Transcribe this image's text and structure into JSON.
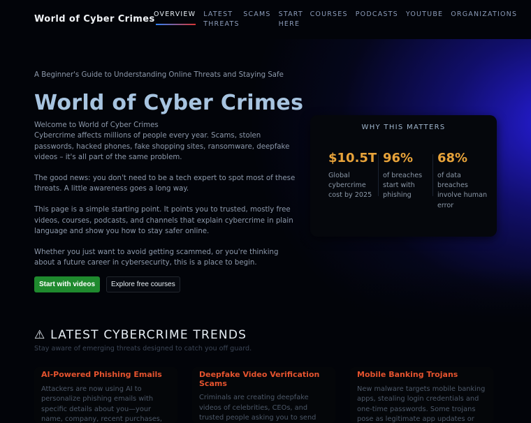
{
  "brand": "World of Cyber Crimes",
  "nav": [
    {
      "label": "OVERVIEW",
      "active": true
    },
    {
      "label": "LATEST THREATS"
    },
    {
      "label": "SCAMS"
    },
    {
      "label": "START HERE"
    },
    {
      "label": "COURSES"
    },
    {
      "label": "PODCASTS"
    },
    {
      "label": "YOUTUBE"
    },
    {
      "label": "ORGANIZATIONS"
    }
  ],
  "hero": {
    "tagline": "A Beginner's Guide to Understanding Online Threats and Staying Safe",
    "title": "World of Cyber Crimes",
    "welcome": "Welcome to World of Cyber Crimes",
    "p1": "Cybercrime affects millions of people every year. Scams, stolen passwords, hacked phones, fake shopping sites, ransomware, deepfake videos – it's all part of the same problem.",
    "p2": "The good news: you don't need to be a tech expert to spot most of these threats. A little awareness goes a long way.",
    "p3": "This page is a simple starting point. It points you to trusted, mostly free videos, courses, podcasts, and channels that explain cybercrime in plain language and show you how to stay safer online.",
    "p4": "Whether you just want to avoid getting scammed, or you're thinking about a future career in cybersecurity, this is a place to begin.",
    "primary_button": "Start with videos",
    "secondary_button": "Explore free courses"
  },
  "stats": {
    "title": "WHY THIS MATTERS",
    "items": [
      {
        "value": "$10.5T",
        "label": "Global cybercrime cost by 2025"
      },
      {
        "value": "96%",
        "label": "of breaches start with phishing"
      },
      {
        "value": "68%",
        "label": "of data breaches involve human error"
      }
    ]
  },
  "trends": {
    "icon": "warning-icon",
    "icon_glyph": "⚠",
    "title": "LATEST CYBERCRIME TRENDS",
    "subtitle": "Stay aware of emerging threats designed to catch you off guard.",
    "cards": [
      {
        "title": "AI-Powered Phishing Emails",
        "body": "Attackers are now using AI to personalize phishing emails with specific details about you—your name, company, recent purchases, or colleagues. These messages"
      },
      {
        "title": "Deepfake Video Verification Scams",
        "body": "Criminals are creating deepfake videos of celebrities, CEOs, and trusted people asking you to send money or crypto"
      },
      {
        "title": "Mobile Banking Trojans",
        "body": "New malware targets mobile banking apps, stealing login credentials and one-time passwords. Some trojans pose as legitimate app updates or security"
      }
    ]
  },
  "colors": {
    "accent_orange": "#e8a33a",
    "card_title_red": "#e5532e",
    "primary_green": "#1f8a2e",
    "title_blue": "#a7c4e0",
    "glow_blue": "#2a1ee6"
  }
}
